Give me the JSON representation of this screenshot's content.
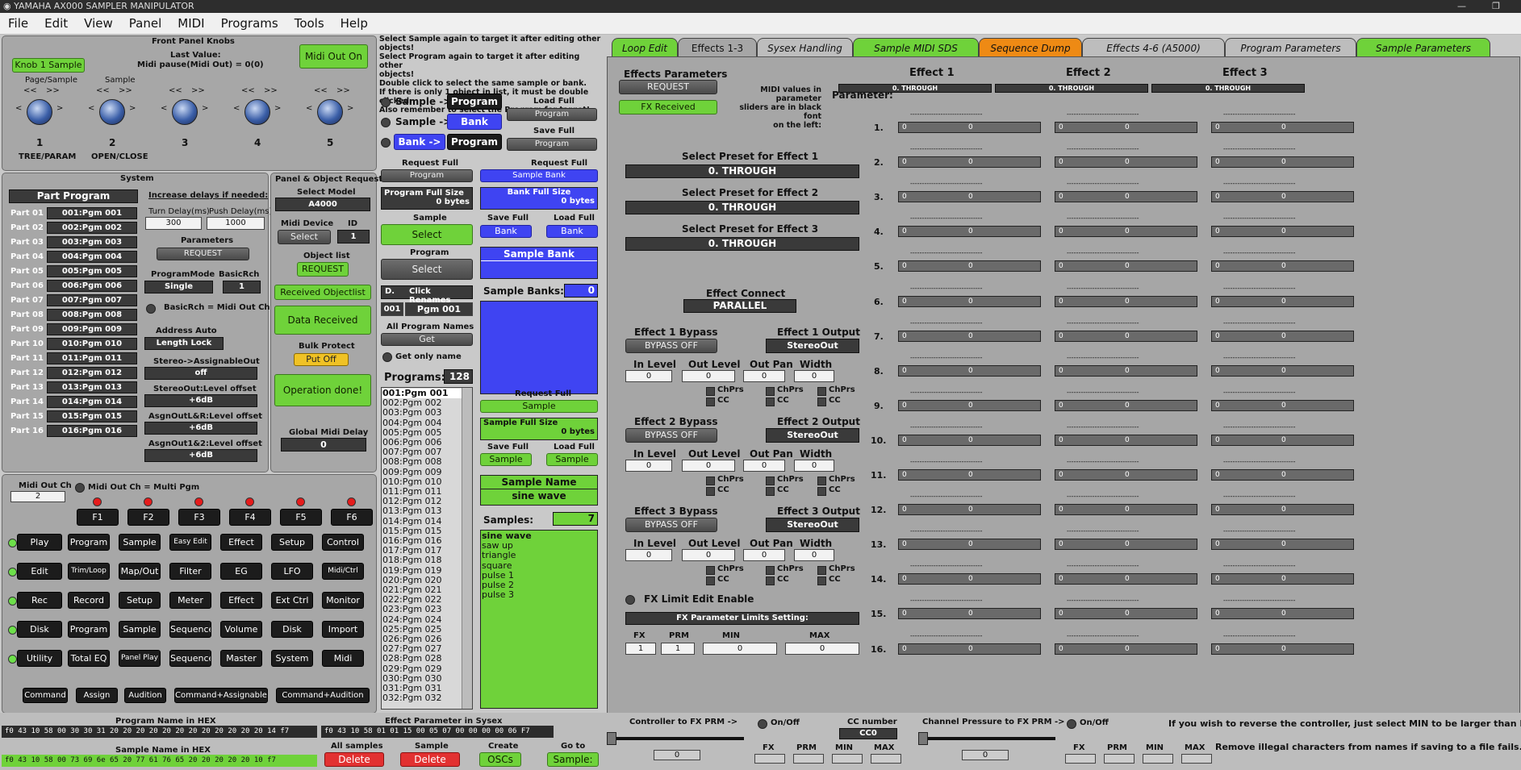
{
  "window": {
    "title": "YAMAHA AX000 SAMPLER MANIPULATOR"
  },
  "menu": [
    "File",
    "Edit",
    "View",
    "Panel",
    "MIDI",
    "Programs",
    "Tools",
    "Help"
  ],
  "front_panel": {
    "title": "Front Panel Knobs",
    "knob1_button": "Knob 1 Sample",
    "last_value_label": "Last Value:",
    "last_value": "Midi pause(Midi Out) = 0(0)",
    "midi_out_on": "Midi Out On",
    "page_sample_label": "Page/Sample",
    "sample_label": "Sample",
    "knobs": [
      "1",
      "2",
      "3",
      "4",
      "5"
    ],
    "knob1_sub": "TREE/PARAM",
    "knob2_sub": "OPEN/CLOSE"
  },
  "system": {
    "title": "System",
    "part_program": "Part Program",
    "parts": [
      {
        "part": "Part 01",
        "pgm": "001:Pgm 001"
      },
      {
        "part": "Part 02",
        "pgm": "002:Pgm 002"
      },
      {
        "part": "Part 03",
        "pgm": "003:Pgm 003"
      },
      {
        "part": "Part 04",
        "pgm": "004:Pgm 004"
      },
      {
        "part": "Part 05",
        "pgm": "005:Pgm 005"
      },
      {
        "part": "Part 06",
        "pgm": "006:Pgm 006"
      },
      {
        "part": "Part 07",
        "pgm": "007:Pgm 007"
      },
      {
        "part": "Part 08",
        "pgm": "008:Pgm 008"
      },
      {
        "part": "Part 09",
        "pgm": "009:Pgm 009"
      },
      {
        "part": "Part 10",
        "pgm": "010:Pgm 010"
      },
      {
        "part": "Part 11",
        "pgm": "011:Pgm 011"
      },
      {
        "part": "Part 12",
        "pgm": "012:Pgm 012"
      },
      {
        "part": "Part 13",
        "pgm": "013:Pgm 013"
      },
      {
        "part": "Part 14",
        "pgm": "014:Pgm 014"
      },
      {
        "part": "Part 15",
        "pgm": "015:Pgm 015"
      },
      {
        "part": "Part 16",
        "pgm": "016:Pgm 016"
      }
    ],
    "increase_delays": "Increase delays if needed:",
    "turn_delay_label": "Turn Delay(ms)",
    "turn_delay": "300",
    "push_delay_label": "Push Delay(ms)",
    "push_delay": "1000",
    "parameters": "Parameters",
    "request": "REQUEST",
    "program_mode_label": "ProgramMode",
    "program_mode": "Single",
    "basic_rch_label": "BasicRch",
    "basic_rch": "1",
    "basic_rch_midi": "BasicRch = Midi Out Ch",
    "address_auto": "Address Auto",
    "length_lock": "Length Lock",
    "stereo_assign_label": "Stereo->AssignableOut",
    "stereo_assign": "off",
    "stereo_level_label": "StereoOut:Level offset",
    "stereo_level": "+6dB",
    "asgn_lr_label": "AsgnOutL&R:Level offset",
    "asgn_lr": "+6dB",
    "asgn_12_label": "AsgnOut1&2:Level offset",
    "asgn_12": "+6dB"
  },
  "panel_request": {
    "title": "Panel & Object Request",
    "select_model_label": "Select Model",
    "model": "A4000",
    "midi_device_label": "Midi Device",
    "id_label": "ID",
    "select": "Select",
    "id": "1",
    "object_list": "Object list",
    "request": "REQUEST",
    "received_objectlist": "Received Objectlist",
    "data_received": "Data Received",
    "bulk_protect": "Bulk Protect",
    "put_off": "Put Off",
    "operation_done": "Operation done!",
    "global_midi_delay_label": "Global Midi Delay",
    "global_midi_delay": "0"
  },
  "bottom_left": {
    "midi_out_ch_label": "Midi Out Ch",
    "midi_out_ch": "2",
    "multi_pgm": "Midi Out Ch = Multi Pgm",
    "fkeys": [
      "F1",
      "F2",
      "F3",
      "F4",
      "F5",
      "F6"
    ],
    "rows": [
      [
        "Play",
        "Program",
        "Sample",
        "Easy Edit",
        "Effect",
        "Setup",
        "Control"
      ],
      [
        "Edit",
        "Trim/Loop",
        "Map/Out",
        "Filter",
        "EG",
        "LFO",
        "Midi/Ctrl"
      ],
      [
        "Rec",
        "Record",
        "Setup",
        "Meter",
        "Effect",
        "Ext Ctrl",
        "Monitor"
      ],
      [
        "Disk",
        "Program",
        "Sample",
        "Sequence",
        "Volume",
        "Disk",
        "Import"
      ],
      [
        "Utility",
        "Total EQ",
        "Panel Play",
        "Sequence",
        "Master",
        "System",
        "Midi"
      ]
    ],
    "commands": [
      "Command",
      "Assign",
      "Audition",
      "Command+Assignable",
      "Command+Audition"
    ]
  },
  "info": {
    "lines": [
      "Select Sample again to target it after editing other objects!",
      "Select Program again to target it after editing other",
      "objects!",
      "Double click to select the same sample or bank.",
      "If there is only 1 object in list, it must be double clicked.",
      "Also remember to select the Program for target!"
    ]
  },
  "middle": {
    "sample_prog_a": "Sample ->",
    "prog_a": "Program",
    "sample_bank": "Sample ->",
    "bank": "Bank",
    "bank_prog": "Bank ->",
    "prog_b": "Program",
    "load_full": "Load Full",
    "save_full": "Save Full",
    "program": "Program",
    "request_full": "Request Full",
    "sample_bank_btn": "Sample Bank",
    "program_full_size": "Program Full Size",
    "program_bytes": "0 bytes",
    "bank_full_size": "Bank Full Size",
    "bank_bytes": "0 bytes",
    "sample_label": "Sample",
    "select": "Select",
    "bank_btn": "Bank",
    "program_label": "Program",
    "sample_bank_title": "Sample Bank",
    "d_label": "D.",
    "click_renames": "Click Renames",
    "pgm_num": "001",
    "pgm_name": "Pgm 001",
    "all_program_names": "All Program Names",
    "get": "Get",
    "sample_banks_label": "Sample Banks:",
    "sample_banks": "0",
    "get_only_name": "Get only name",
    "programs_label": "Programs:",
    "programs": "128",
    "program_list": [
      "001:Pgm 001",
      "002:Pgm 002",
      "003:Pgm 003",
      "004:Pgm 004",
      "005:Pgm 005",
      "006:Pgm 006",
      "007:Pgm 007",
      "008:Pgm 008",
      "009:Pgm 009",
      "010:Pgm 010",
      "011:Pgm 011",
      "012:Pgm 012",
      "013:Pgm 013",
      "014:Pgm 014",
      "015:Pgm 015",
      "016:Pgm 016",
      "017:Pgm 017",
      "018:Pgm 018",
      "019:Pgm 019",
      "020:Pgm 020",
      "021:Pgm 021",
      "022:Pgm 022",
      "023:Pgm 023",
      "024:Pgm 024",
      "025:Pgm 025",
      "026:Pgm 026",
      "027:Pgm 027",
      "028:Pgm 028",
      "029:Pgm 029",
      "030:Pgm 030",
      "031:Pgm 031",
      "032:Pgm 032"
    ],
    "sample_btn": "Sample",
    "sample_full_size": "Sample Full Size",
    "sample_bytes": "0 bytes",
    "sample_name_label": "Sample Name",
    "sample_name": "sine wave",
    "samples_label": "Samples:",
    "samples": "7",
    "sample_list": [
      "sine wave",
      "saw up",
      "triangle",
      "square",
      "pulse 1",
      "pulse 2",
      "pulse 3"
    ]
  },
  "tabs": [
    {
      "label": "Loop Edit",
      "color": "#6fd23a"
    },
    {
      "label": "Effects 1-3",
      "color": "#a6a6a6"
    },
    {
      "label": "Sysex Handling",
      "color": "#bdbdbd"
    },
    {
      "label": "Sample MIDI SDS",
      "color": "#6fd23a"
    },
    {
      "label": "Sequence Dump",
      "color": "#ee8a14"
    },
    {
      "label": "Effects 4-6 (A5000)",
      "color": "#bdbdbd"
    },
    {
      "label": "Program Parameters",
      "color": "#bdbdbd"
    },
    {
      "label": "Sample Parameters",
      "color": "#6fd23a"
    }
  ],
  "effects": {
    "title": "Effects Parameters",
    "request": "REQUEST",
    "fx_received": "FX Received",
    "parameter_label": "Parameter:",
    "effect_headers": [
      "Effect 1",
      "Effect 2",
      "Effect 3"
    ],
    "effect_names": [
      "0. THROUGH",
      "0. THROUGH",
      "0. THROUGH"
    ],
    "midi_note": [
      "MIDI values in parameter",
      "sliders are in black font",
      "on the left:"
    ],
    "preset_labels": [
      "Select Preset for Effect 1",
      "Select Preset for Effect 2",
      "Select Preset for Effect 3"
    ],
    "presets": [
      "0. THROUGH",
      "0. THROUGH",
      "0. THROUGH"
    ],
    "effect_connect_label": "Effect Connect",
    "effect_connect": "PARALLEL",
    "bypass_labels": [
      "Effect 1 Bypass",
      "Effect 2 Bypass",
      "Effect 3 Bypass"
    ],
    "output_labels": [
      "Effect 1 Output",
      "Effect 2 Output",
      "Effect 3 Output"
    ],
    "bypass": "BYPASS OFF",
    "output": "StereoOut",
    "in_level": "In Level",
    "out_level": "Out Level",
    "out_pan": "Out Pan",
    "width": "Width",
    "zero": "0",
    "chprs": "ChPrs",
    "cc": "CC",
    "fx_limit": "FX Limit Edit Enable",
    "limits_title": "FX Parameter Limits Setting:",
    "limit_cols": [
      "FX",
      "PRM",
      "MIN",
      "MAX"
    ],
    "limit_vals": [
      "1",
      "1",
      "0",
      "0"
    ],
    "param_numbers": [
      "1.",
      "2.",
      "3.",
      "4.",
      "5.",
      "6.",
      "7.",
      "8.",
      "9.",
      "10.",
      "11.",
      "12.",
      "13.",
      "14.",
      "15.",
      "16."
    ],
    "dashes": "-------------------------------"
  },
  "bottom": {
    "program_name_hex_label": "Program Name in HEX",
    "program_name_hex": "f0 43 10 58 00 30 30 31 20 20 20 20 20 20 20 20 20 20 20 20 14 f7",
    "effect_param_label": "Effect Parameter in Sysex",
    "effect_param": "f0 43 10 58 01 01 15 00 05 07 00 00 00 00 06 F7",
    "sample_name_hex_label": "Sample Name in HEX",
    "sample_name_hex": "f0 43 10 58 00 73 69 6e 65 20 77 61 76 65 20 20 20 20 20 10 f7",
    "all_samples": "All samples",
    "sample": "Sample",
    "create": "Create",
    "go_to": "Go to",
    "delete": "Delete",
    "oscs": "OSCs",
    "go_sample": "Sample:",
    "ctrl_fx": "Controller to FX PRM ->",
    "on_off": "On/Off",
    "cc_number_label": "CC number",
    "cc_number": "CC0",
    "chpres_fx": "Channel Pressure to FX PRM ->",
    "note1": "If you wish to reverse the controller, just select MIN to be larger than MAX limit.",
    "note2": "Remove illegal characters from names if saving to a file fails.",
    "zero": "0",
    "fx": "FX",
    "prm": "PRM",
    "min": "MIN",
    "max": "MAX"
  }
}
